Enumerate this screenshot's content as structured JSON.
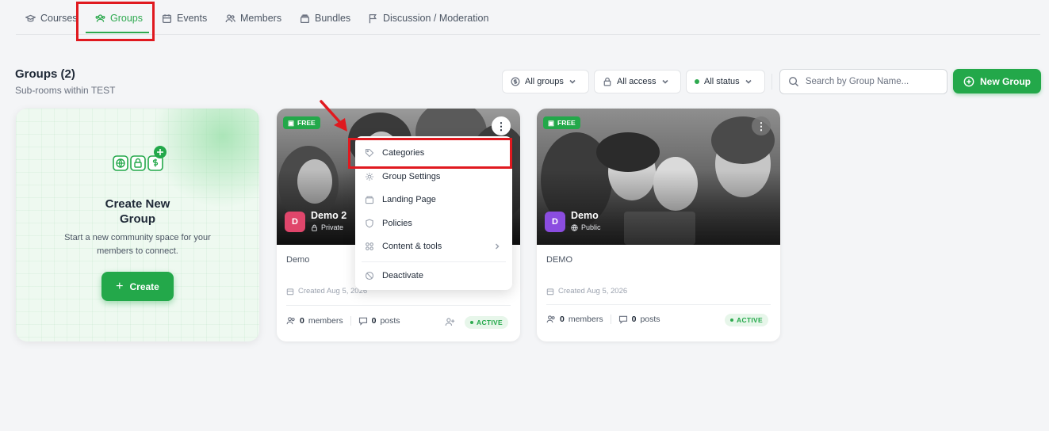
{
  "tabs": [
    {
      "label": "Courses",
      "icon": "graduation-cap-icon"
    },
    {
      "label": "Groups",
      "icon": "users-group-icon",
      "active": true
    },
    {
      "label": "Events",
      "icon": "calendar-icon"
    },
    {
      "label": "Members",
      "icon": "members-icon"
    },
    {
      "label": "Bundles",
      "icon": "bundle-icon"
    },
    {
      "label": "Discussion / Moderation",
      "icon": "flag-icon"
    }
  ],
  "header": {
    "title": "Groups (2)",
    "subtitle": "Sub-rooms within TEST"
  },
  "filters": {
    "groups": "All groups",
    "access": "All access",
    "status": "All status"
  },
  "search": {
    "placeholder": "Search by Group Name..."
  },
  "new_group_label": "New Group",
  "create_card": {
    "title_line1": "Create New",
    "title_line2": "Group",
    "description": "Start a new community space for your members to connect.",
    "button_label": "Create"
  },
  "groups": [
    {
      "badge": "FREE",
      "avatar_letter": "D",
      "avatar_color": "#e0466b",
      "name": "Demo 2",
      "visibility": "Private",
      "description": "Demo",
      "created": "Created Aug 5, 2026",
      "members_count": "0",
      "members_label": "members",
      "posts_count": "0",
      "posts_label": "posts",
      "status": "ACTIVE"
    },
    {
      "badge": "FREE",
      "avatar_letter": "D",
      "avatar_color": "#8b4de0",
      "name": "Demo",
      "visibility": "Public",
      "description": "DEMO",
      "created": "Created Aug 5, 2026",
      "members_count": "0",
      "members_label": "members",
      "posts_count": "0",
      "posts_label": "posts",
      "status": "ACTIVE"
    }
  ],
  "menu": {
    "items": [
      {
        "label": "Categories",
        "icon": "tag-icon"
      },
      {
        "label": "Group Settings",
        "icon": "gear-icon"
      },
      {
        "label": "Landing Page",
        "icon": "page-icon"
      },
      {
        "label": "Policies",
        "icon": "shield-icon"
      },
      {
        "label": "Content & tools",
        "icon": "grid-icon"
      },
      {
        "label": "Deactivate",
        "icon": "ban-icon"
      }
    ]
  },
  "colors": {
    "accent": "#23a84a",
    "annotation": "#e0191f"
  }
}
